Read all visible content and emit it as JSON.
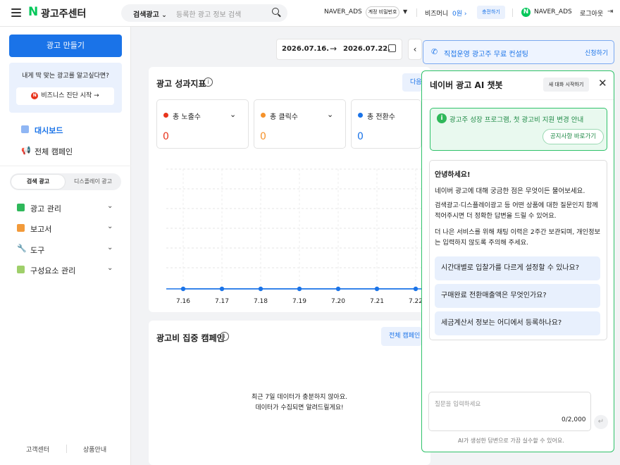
{
  "header": {
    "brand_n": "N",
    "brand": "광고주센터",
    "search_scope": "검색광고",
    "search_placeholder": "등록한 광고 정보 검색",
    "account": "NAVER_ADS",
    "account_badge": "계정 비밀번호",
    "bizmoney_label": "비즈머니",
    "bizmoney_value": "0원",
    "charge": "충전하기",
    "user_badge": "N",
    "user": "NAVER_ADS",
    "logout": "로그아웃"
  },
  "sidebar": {
    "create": "광고 만들기",
    "promo_title": "내게 딱 맞는 광고를 알고싶다면?",
    "promo_badge": "N",
    "promo_button": "비즈니스 진단 시작 →",
    "nav": [
      {
        "label": "대시보드"
      },
      {
        "label": "전체 캠페인"
      }
    ],
    "seg": [
      "검색 광고",
      "디스플레이 광고"
    ],
    "groups": [
      {
        "label": "광고 관리"
      },
      {
        "label": "보고서"
      },
      {
        "label": "도구"
      },
      {
        "label": "구성요소 관리"
      }
    ],
    "footer": [
      "고객센터",
      "상품안내"
    ]
  },
  "date": {
    "start": "2026.07.16.",
    "end": "2026.07.22."
  },
  "kpi": {
    "title": "광고 성과지표",
    "next_btn": "다음",
    "cards": [
      {
        "label": "총 노출수",
        "value": "0",
        "color": "#e8341c"
      },
      {
        "label": "총 클릭수",
        "value": "0",
        "color": "#f5922b"
      },
      {
        "label": "총 전환수",
        "value": "0",
        "color": "#1a73e8"
      }
    ]
  },
  "chart_data": {
    "type": "line",
    "categories": [
      "7.16",
      "7.17",
      "7.18",
      "7.19",
      "7.20",
      "7.21",
      "7.22"
    ],
    "series": [
      {
        "values": [
          0,
          0,
          0,
          0,
          0,
          0,
          0
        ]
      }
    ],
    "color": "#1a73e8",
    "grid": true
  },
  "campaign": {
    "title": "광고비 집중 캠페인",
    "all_btn": "전체 캠페인",
    "empty_1": "최근 7일 데이터가 충분하지 않아요.",
    "empty_2": "데이터가 수집되면 알려드릴게요!"
  },
  "consult": {
    "text": "직접운영 광고주 무료 컨설팅",
    "link": "신청하기"
  },
  "chat": {
    "title": "네이버 광고 AI 챗봇",
    "new": "새 대화 시작하기",
    "notice": "광고주 성장 프로그램, 첫 광고비 지원 변경 안내",
    "notice_btn": "공지사항 바로가기",
    "greet": "안녕하세요!",
    "p1": "네이버 광고에 대해 궁금한 점은 무엇이든 물어보세요.",
    "p2a": "검색광고·디스플레이광고 등 어떤 상품에 대한 질문인지 함께",
    "p2b": "적어주시면 더 정확한 답변을 드릴 수 있어요.",
    "p3a": "더 나은 서비스를 위해 채팅 이력은 2주간 보관되며, 개인정보",
    "p3b": "는 입력하지 않도록 주의해 주세요.",
    "questions": [
      "시간대별로 입찰가를 다르게 설정할 수 있나요?",
      "구매완료 전환매출액은 무엇인가요?",
      "세금계산서 정보는 어디에서 등록하나요?"
    ],
    "input_placeholder": "질문을 입력하세요",
    "counter": "0/2,000",
    "disclaimer": "AI가 생성한 답변으로 가끔 실수할 수 있어요."
  }
}
